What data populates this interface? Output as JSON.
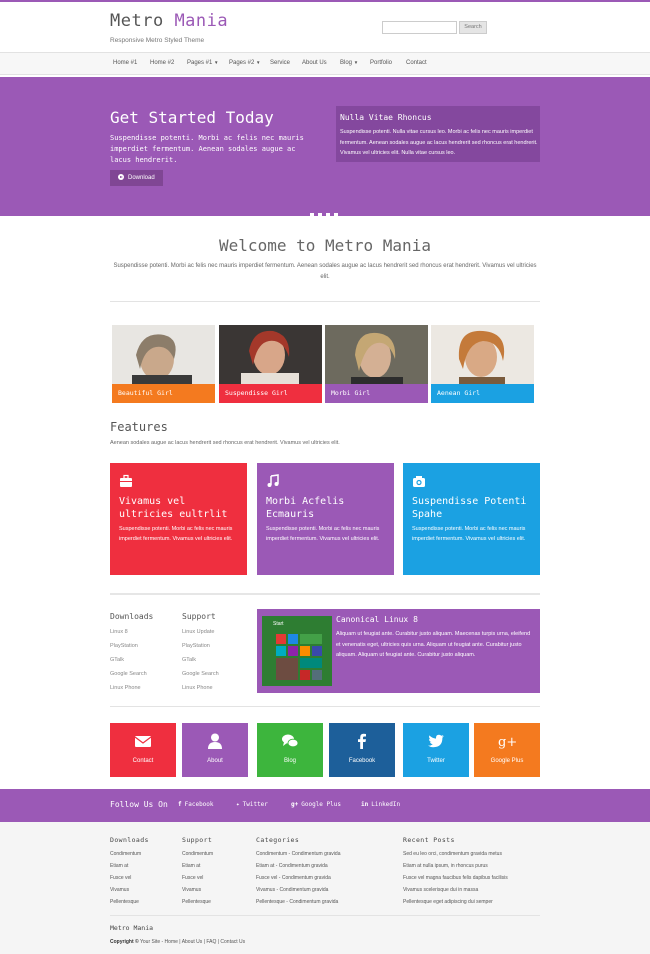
{
  "header": {
    "logo_part1": "Metro",
    "logo_part2": "Mania",
    "tagline": "Responsive Metro Styled Theme",
    "search_button": "Search"
  },
  "nav": {
    "items": [
      "Home #1",
      "Home #2",
      "Pages #1",
      "Pages #2",
      "Service",
      "About Us",
      "Blog",
      "Portfolio",
      "Contact"
    ]
  },
  "hero": {
    "title": "Get Started Today",
    "text": "Suspendisse potenti. Morbi ac felis nec mauris imperdiet fermentum. Aenean sodales augue ac lacus hendrerit.",
    "button": "Download",
    "box_title": "Nulla Vitae Rhoncus",
    "box_text": "Suspendisse potenti. Nulla vitae cursus leo. Morbi ac felis nec mauris imperdiet fermentum. Aenean sodales augue ac lacus hendrerit sed rhoncus erat hendrerit. Vivamus vel ultricies elit. Nulla vitae cursus leo."
  },
  "welcome": {
    "title": "Welcome to Metro Mania",
    "text": "Suspendisse potenti. Morbi ac felis nec mauris imperdiet fermentum. Aenean sodales augue ac lacus hendrerit sed rhoncus erat hendrerit. Vivamus vel ultricies elit."
  },
  "gallery": [
    {
      "caption": "Beautiful Girl",
      "color": "#f47a1f"
    },
    {
      "caption": "Suspendisse Girl",
      "color": "#ef2f3f"
    },
    {
      "caption": "Morbi Girl",
      "color": "#9b59b6"
    },
    {
      "caption": "Aenean Girl",
      "color": "#1ba1e2"
    }
  ],
  "features": {
    "title": "Features",
    "subtitle": "Aenean sodales augue ac lacus hendrerit sed rhoncus erat hendrerit. Vivamus vel ultricies elit.",
    "items": [
      {
        "icon": "briefcase-icon",
        "title": "Vivamus vel ultricies eultrlit",
        "text": "Suspendisse potenti. Morbi ac felis nec mauris imperdiet fermentum. Vivamus vel ultricies elit.",
        "color": "#ef2f3f"
      },
      {
        "icon": "music-icon",
        "title": "Morbi Acfelis Ecmauris",
        "text": "Suspendisse potenti. Morbi ac felis nec mauris imperdiet fermentum. Vivamus vel ultricies elit.",
        "color": "#9b59b6"
      },
      {
        "icon": "camera-icon",
        "title": "Suspendisse Potenti Spahe",
        "text": "Suspendisse potenti. Morbi ac felis nec mauris imperdiet fermentum. Vivamus vel ultricies elit.",
        "color": "#1ba1e2"
      }
    ]
  },
  "links": {
    "downloads_title": "Downloads",
    "downloads": [
      "Linux 8",
      "PlayStation",
      "GTalk",
      "Google Search",
      "Linux Phone"
    ],
    "support_title": "Support",
    "support": [
      "Linux Update",
      "PlayStation",
      "GTalk",
      "Google Search",
      "Linux Phone"
    ]
  },
  "linux": {
    "title": "Canonical Linux 8",
    "text": "Aliquam ut feugiat ante. Curabitur justo aliquam. Maecenas turpis urna, eleifend et venenatis eget, ultricies quis urna. Aliquam ut feugiat ante. Curabitur justo aliquam. Aliquam ut feugiat ante. Curabitur justo aliquam.",
    "start_label": "Start"
  },
  "social_tiles": [
    {
      "label": "Contact",
      "icon": "envelope-icon",
      "color": "#ef2f3f"
    },
    {
      "label": "About",
      "icon": "user-icon",
      "color": "#9b59b6"
    },
    {
      "label": "Blog",
      "icon": "chat-icon",
      "color": "#3db53d"
    },
    {
      "label": "Facebook",
      "icon": "facebook-icon",
      "color": "#1d5f9a"
    },
    {
      "label": "Twitter",
      "icon": "twitter-icon",
      "color": "#1ba1e2"
    },
    {
      "label": "Google Plus",
      "icon": "google-plus-icon",
      "color": "#f47a1f"
    }
  ],
  "follow": {
    "title": "Follow Us On",
    "links": [
      {
        "glyph": "f",
        "label": "Facebook"
      },
      {
        "glyph": "✦",
        "label": "Twitter"
      },
      {
        "glyph": "g+",
        "label": "Google Plus"
      },
      {
        "glyph": "in",
        "label": "LinkedIn"
      }
    ]
  },
  "footer": {
    "columns": [
      {
        "title": "Downloads",
        "items": [
          "Condimentum",
          "Etiam at",
          "Fusce vel",
          "Vivamus",
          "Pellentesque"
        ]
      },
      {
        "title": "Support",
        "items": [
          "Condimentum",
          "Etiam at",
          "Fusce vel",
          "Vivamus",
          "Pellentesque"
        ]
      },
      {
        "title": "Categories",
        "items": [
          "Condimentum - Condimentum gravida",
          "Etiam at - Condimentum gravida",
          "Fusce vel - Condimentum gravida",
          "Vivamus - Condimentum gravida",
          "Pellentesque - Condimentum gravida"
        ]
      },
      {
        "title": "Recent Posts",
        "items": [
          "Sed eu leo orci, condimentum gravida metus",
          "Etiam at nulla ipsum, in rhoncus purus",
          "Fusce vel magna faucibus felis dapibus facilisis",
          "Vivamus scelerisque dui in massa",
          "Pellentesque eget adipiscing dui semper"
        ]
      }
    ],
    "brand": "Metro Mania",
    "copyright_prefix": "Copyright ©",
    "copyright_links": "Your Site - Home | About Us | FAQ | Contact Us"
  },
  "colors": {
    "purple": "#9b59b6",
    "red": "#ef2f3f",
    "blue": "#1ba1e2",
    "orange": "#f47a1f",
    "green": "#3db53d",
    "navy": "#1d5f9a"
  }
}
